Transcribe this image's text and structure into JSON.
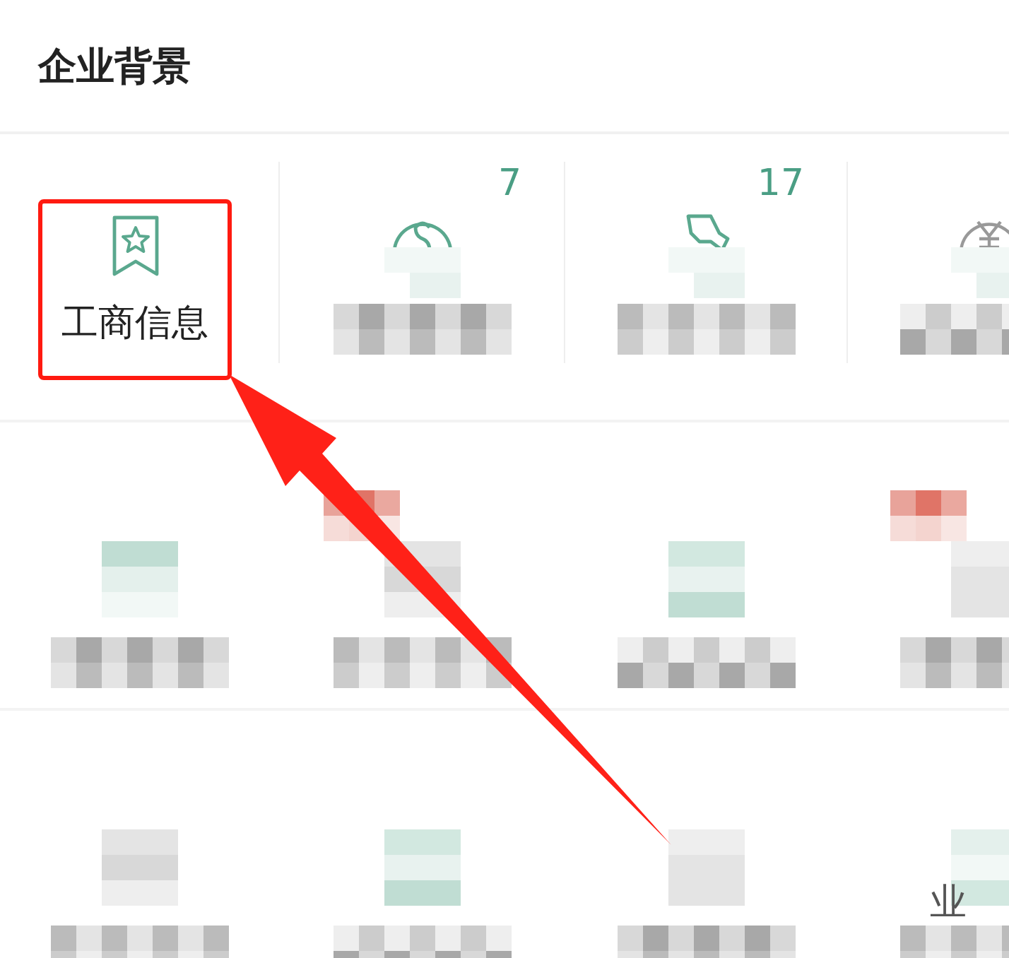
{
  "title": "企业背景",
  "rows": [
    {
      "cells": [
        {
          "kind": "item",
          "label": "工商信息",
          "highlighted": true
        },
        {
          "kind": "pixelated-icon",
          "badge": "7"
        },
        {
          "kind": "pixelated-icon",
          "badge": "17"
        },
        {
          "kind": "pixelated-icon"
        }
      ]
    },
    {
      "cells": [
        {
          "kind": "pixelated",
          "tagged": false
        },
        {
          "kind": "pixelated",
          "tagged": true
        },
        {
          "kind": "pixelated",
          "tagged": false
        },
        {
          "kind": "pixelated",
          "tagged": true
        }
      ]
    },
    {
      "cells": [
        {
          "kind": "pixelated",
          "tagged": false
        },
        {
          "kind": "pixelated",
          "tagged": false
        },
        {
          "kind": "pixelated",
          "tagged": false
        },
        {
          "kind": "pixelated",
          "tagged": false,
          "caption": "业"
        }
      ]
    }
  ],
  "annotation": {
    "kind": "arrow"
  }
}
